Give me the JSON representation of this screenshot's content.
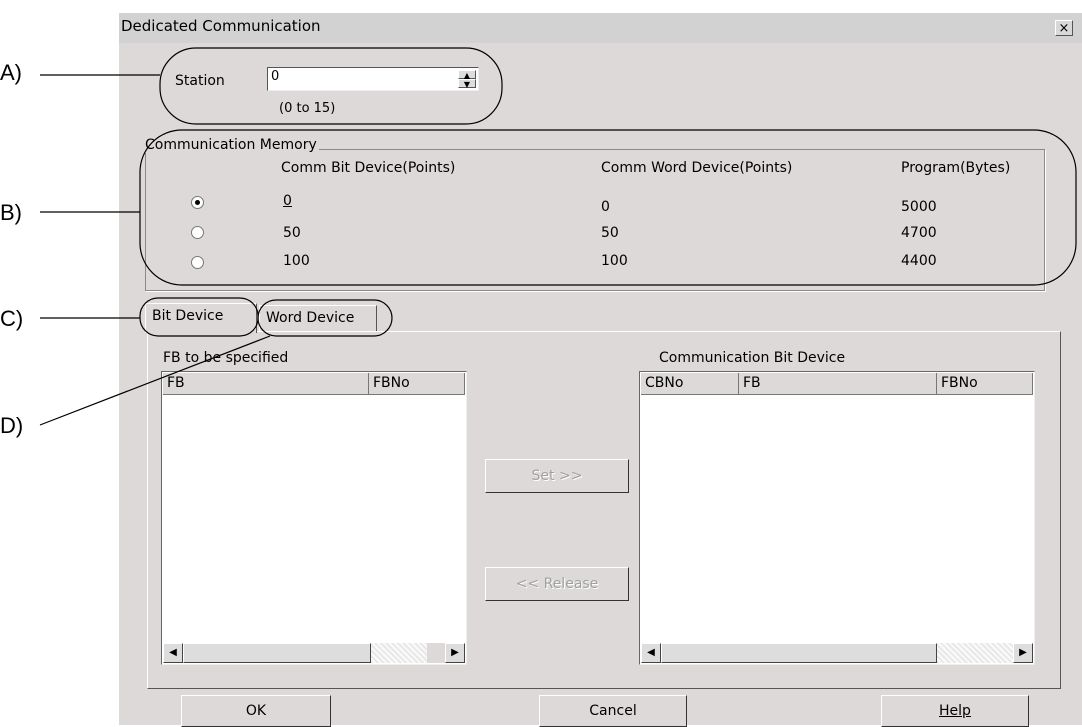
{
  "dialog": {
    "title": "Dedicated Communication",
    "close_glyph": "×"
  },
  "callouts": [
    "A)",
    "B)",
    "C)",
    "D)"
  ],
  "station": {
    "label": "Station",
    "value": "0",
    "range_hint": "(0 to 15)",
    "spin_up": "▲",
    "spin_down": "▼"
  },
  "comm_memory": {
    "group_title": "Communication Memory",
    "headers": [
      "Comm Bit Device(Points)",
      "Comm Word Device(Points)",
      "Program(Bytes)"
    ],
    "rows": [
      {
        "selected": true,
        "bit": "0",
        "word": "0",
        "program": "5000"
      },
      {
        "selected": false,
        "bit": "50",
        "word": "50",
        "program": "4700"
      },
      {
        "selected": false,
        "bit": "100",
        "word": "100",
        "program": "4400"
      }
    ]
  },
  "tabs": [
    {
      "label": "Bit Device",
      "active": true
    },
    {
      "label": "Word Device",
      "active": false
    }
  ],
  "left_list": {
    "caption": "FB to be specified",
    "columns": [
      "FB",
      "FBNo"
    ]
  },
  "right_list": {
    "caption": "Communication Bit Device",
    "columns": [
      "CBNo",
      "FB",
      "FBNo"
    ]
  },
  "middle_buttons": {
    "set": "Set >>",
    "release": "<< Release"
  },
  "scroll": {
    "left_arrow": "◀",
    "right_arrow": "▶"
  },
  "footer": {
    "ok": "OK",
    "cancel": "Cancel",
    "help": "Help"
  }
}
